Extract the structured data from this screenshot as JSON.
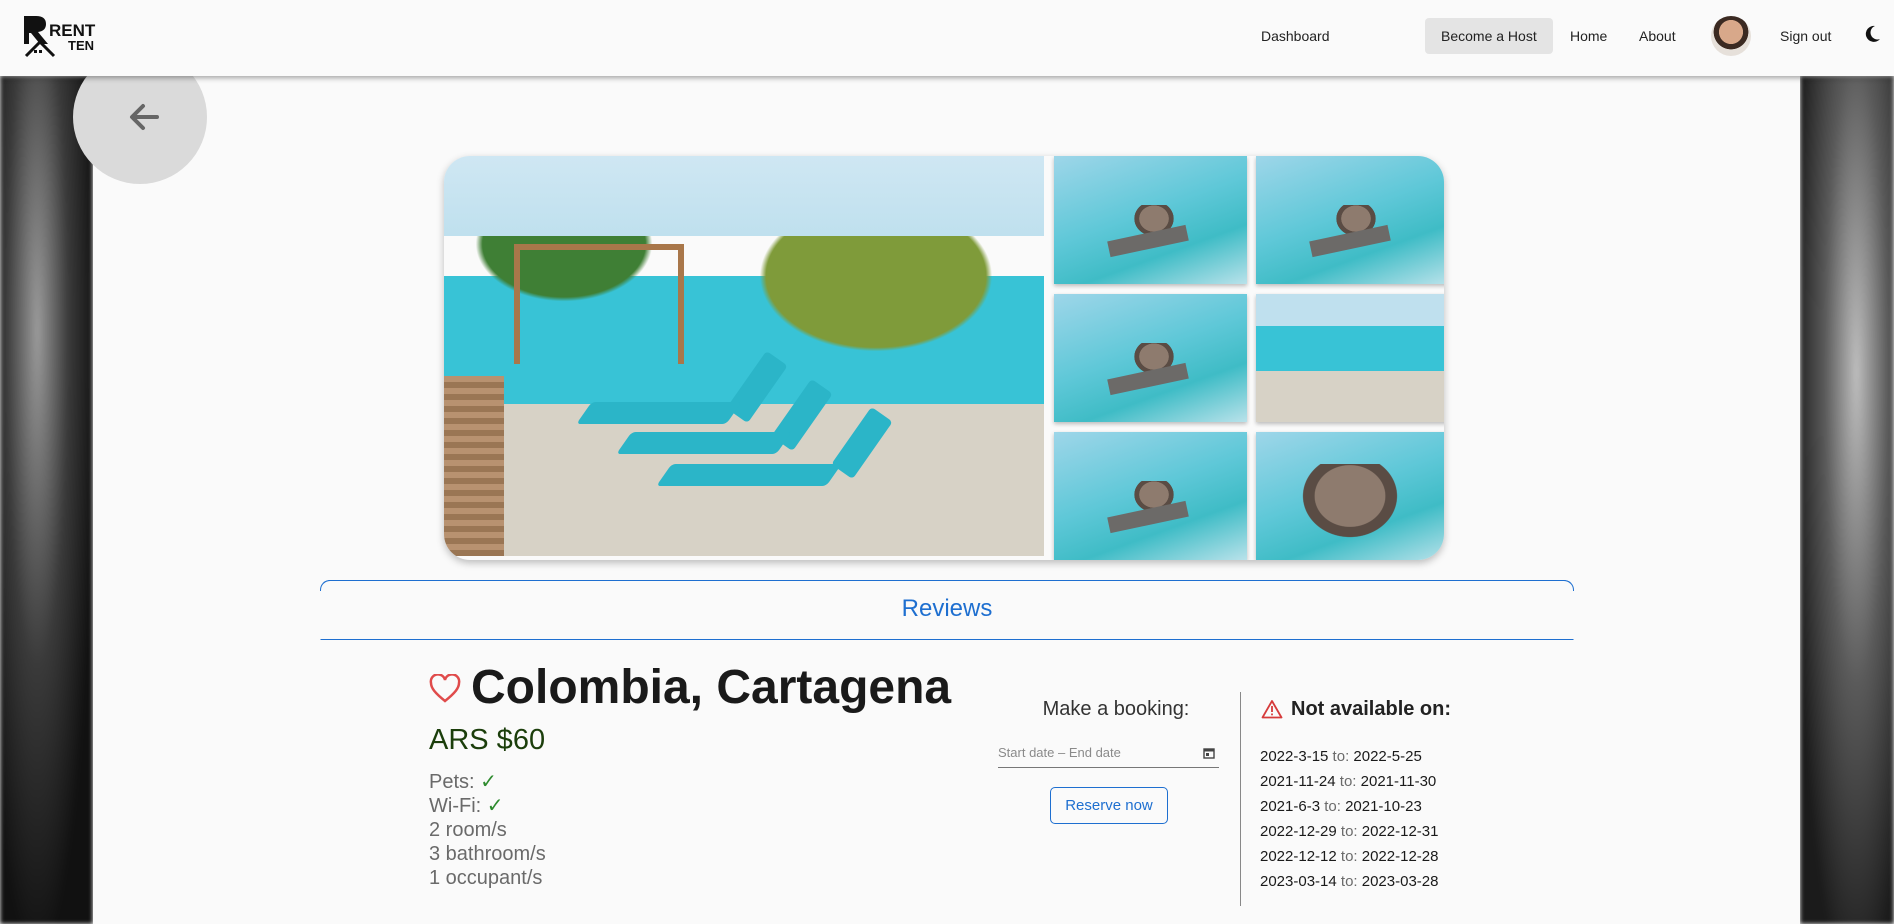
{
  "navbar": {
    "logo_text_top": "RENT",
    "logo_text_bottom": "TEN",
    "dashboard": "Dashboard",
    "become_host": "Become a Host",
    "home": "Home",
    "about": "About",
    "sign_out": "Sign out",
    "theme_icon": "moon-icon"
  },
  "gallery": {
    "photo_count": 7
  },
  "reviews": {
    "label": "Reviews"
  },
  "listing": {
    "title": "Colombia, Cartagena",
    "price": "ARS $60",
    "features": [
      {
        "label": "Pets: ",
        "value": "✓"
      },
      {
        "label": "Wi-Fi: ",
        "value": "✓"
      }
    ],
    "rooms": "2 room/s",
    "bathrooms": "3 bathroom/s",
    "occupants": "1 occupant/s"
  },
  "booking": {
    "title": "Make a booking:",
    "date_placeholder": "Start date – End date",
    "reserve_label": "Reserve now"
  },
  "availability": {
    "title": "Not available on:",
    "to_label": " to: ",
    "ranges": [
      {
        "from": "2022-3-15",
        "to": "2022-5-25"
      },
      {
        "from": "2021-11-24",
        "to": "2021-11-30"
      },
      {
        "from": "2021-6-3",
        "to": "2021-10-23"
      },
      {
        "from": "2022-12-29",
        "to": "2022-12-31"
      },
      {
        "from": "2022-12-12",
        "to": "2022-12-28"
      },
      {
        "from": "2023-03-14",
        "to": "2023-03-28"
      }
    ]
  },
  "colors": {
    "accent": "#1e6fd0",
    "price": "#1b3e0b",
    "heart": "#e04b4b",
    "warning": "#d63b3b",
    "check": "#2e8b2e"
  }
}
